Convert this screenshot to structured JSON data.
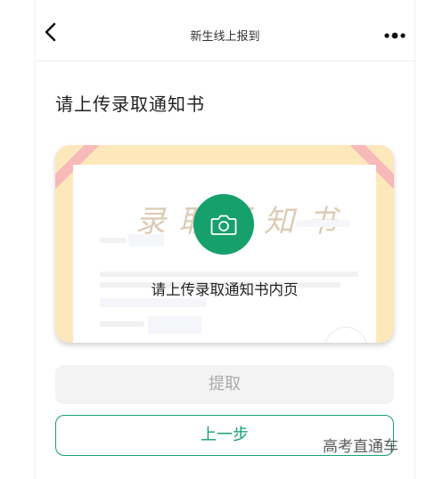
{
  "navbar": {
    "title": "新生线上报到",
    "back_icon": "chevron-left-icon",
    "more_icon": "more-dots-icon"
  },
  "page": {
    "section_title": "请上传录取通知书"
  },
  "upload": {
    "label": "请上传录取通知书内页",
    "icon": "camera-icon",
    "letter_heading": "录取通知书"
  },
  "buttons": {
    "extract_label": "提取",
    "prev_label": "上一步"
  },
  "watermark": {
    "text": "高考直通车"
  },
  "colors": {
    "accent": "#16a06c",
    "card_frame": "#fde8bc",
    "ribbon": "#f8b9b9",
    "disabled_bg": "#f3f3f3",
    "disabled_text": "#a9a9a9"
  }
}
